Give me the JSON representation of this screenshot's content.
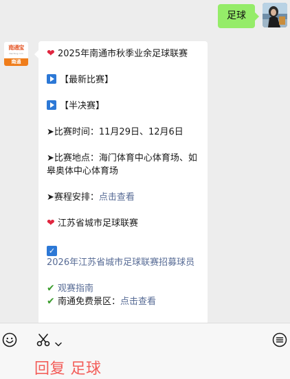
{
  "user_message": {
    "text": "足球"
  },
  "bot_message": {
    "title": "2025年南通市秋季业余足球联赛",
    "latest_games": "【最新比赛】",
    "semifinal": "【半决赛】",
    "match_time": "➤比赛时间：11月29日、12月6日",
    "match_venue": "➤比赛地点：海门体育中心体育场、如皋奥体中心体育场",
    "schedule_prefix": "➤赛程安排：",
    "schedule_link": "点击查看",
    "city_league": "江苏省城市足球联赛",
    "recruit_link": "2026年江苏省城市足球联赛招募球员",
    "guide_link": "观赛指南",
    "free_scenic_prefix": "南通免费景区：",
    "free_scenic_link": "点击查看"
  },
  "bot_logo": {
    "main": "南通宝",
    "sub": "NanTong.com",
    "bottom": "南通"
  },
  "bottom_bar": {
    "reply_text": "回复 足球"
  },
  "colors": {
    "user_bubble": "#95ec69",
    "link": "#576b95",
    "reply": "#f35d59",
    "heart": "#e0263f",
    "check": "#3a9c2c"
  },
  "icons": [
    "emoji-icon",
    "scissors-icon",
    "chevron-down-icon",
    "menu-icon",
    "heart-icon",
    "play-icon",
    "checkbox-icon",
    "check-icon"
  ]
}
